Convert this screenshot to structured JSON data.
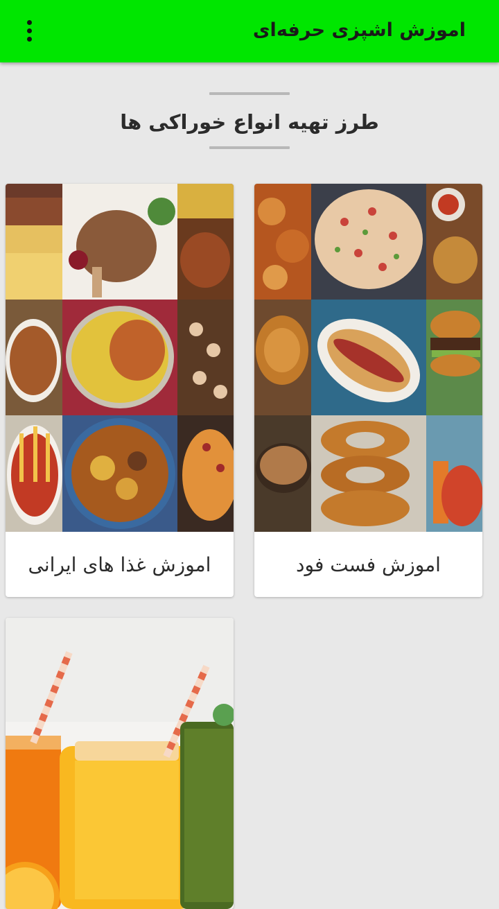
{
  "app": {
    "title": "اموزش اشپزی حرفه‌ای",
    "menu_icon": "more-vert-icon"
  },
  "header": {
    "section_title": "طرز تهیه انواع خوراکی ها"
  },
  "cards": [
    {
      "label": "اموزش فست فود",
      "image": "fast-food-collage-image"
    },
    {
      "label": "اموزش غذا های ایرانی",
      "image": "iranian-food-collage-image"
    },
    {
      "label": "",
      "image": "juice-drinks-image"
    }
  ],
  "colors": {
    "appbar": "#00e600",
    "background": "#e8e8e8",
    "card": "#ffffff"
  }
}
